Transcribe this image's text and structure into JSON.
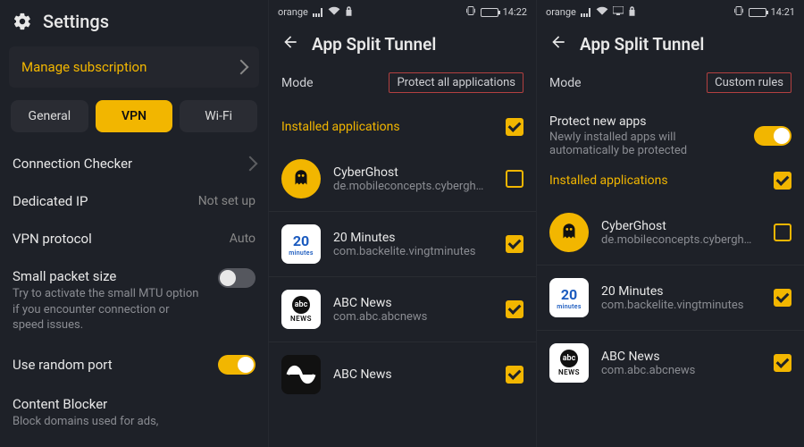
{
  "settings": {
    "title": "Settings",
    "subscription_label": "Manage subscription",
    "tabs": {
      "general": "General",
      "vpn": "VPN",
      "wifi": "Wi-Fi"
    },
    "items": {
      "connection_checker": "Connection Checker",
      "dedicated_ip": "Dedicated IP",
      "dedicated_ip_value": "Not set up",
      "vpn_protocol": "VPN protocol",
      "vpn_protocol_value": "Auto",
      "small_packet_title": "Small packet size",
      "small_packet_desc": "Try to activate the small MTU option if you encounter connection or speed issues.",
      "random_port": "Use random port",
      "content_blocker_title": "Content Blocker",
      "content_blocker_desc": "Block domains used for ads,"
    }
  },
  "status": {
    "carrier": "orange",
    "time_a": "14:22",
    "time_b": "14:21"
  },
  "tunnel": {
    "title": "App Split Tunnel",
    "mode_label": "Mode",
    "mode_protect": "Protect all applications",
    "mode_custom": "Custom rules",
    "installed_label": "Installed applications",
    "protect_new_title": "Protect new apps",
    "protect_new_desc": "Newly installed apps will automatically be protected"
  },
  "apps": [
    {
      "name": "CyberGhost",
      "pkg": "de.mobileconcepts.cybergh…",
      "icon": "ghost",
      "checked_a": false,
      "checked_b": false
    },
    {
      "name": "20 Minutes",
      "pkg": "com.backelite.vingtminutes",
      "icon": "twenty",
      "checked_a": true,
      "checked_b": true
    },
    {
      "name": "ABC News",
      "pkg": "com.abc.abcnews",
      "icon": "abc",
      "checked_a": true,
      "checked_b": true
    },
    {
      "name": "ABC News",
      "pkg": "",
      "icon": "abcau",
      "checked_a": true
    }
  ],
  "colors": {
    "accent": "#f2b600",
    "bg": "#1e2128"
  }
}
